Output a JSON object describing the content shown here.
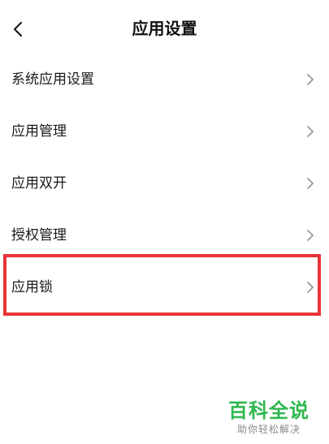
{
  "header": {
    "title": "应用设置",
    "back_icon": "chevron-left-icon"
  },
  "menu": {
    "items": [
      {
        "label": "系统应用设置",
        "icon": "chevron-right-icon"
      },
      {
        "label": "应用管理",
        "icon": "chevron-right-icon"
      },
      {
        "label": "应用双开",
        "icon": "chevron-right-icon"
      },
      {
        "label": "授权管理",
        "icon": "chevron-right-icon"
      },
      {
        "label": "应用锁",
        "icon": "chevron-right-icon"
      }
    ]
  },
  "highlight": {
    "target": "应用锁",
    "color": "#e8343a"
  },
  "watermark": {
    "title": "百科全说",
    "subtitle": "助你轻松解决",
    "title_color": "#2db84d",
    "subtitle_color": "#8a8a8a"
  }
}
